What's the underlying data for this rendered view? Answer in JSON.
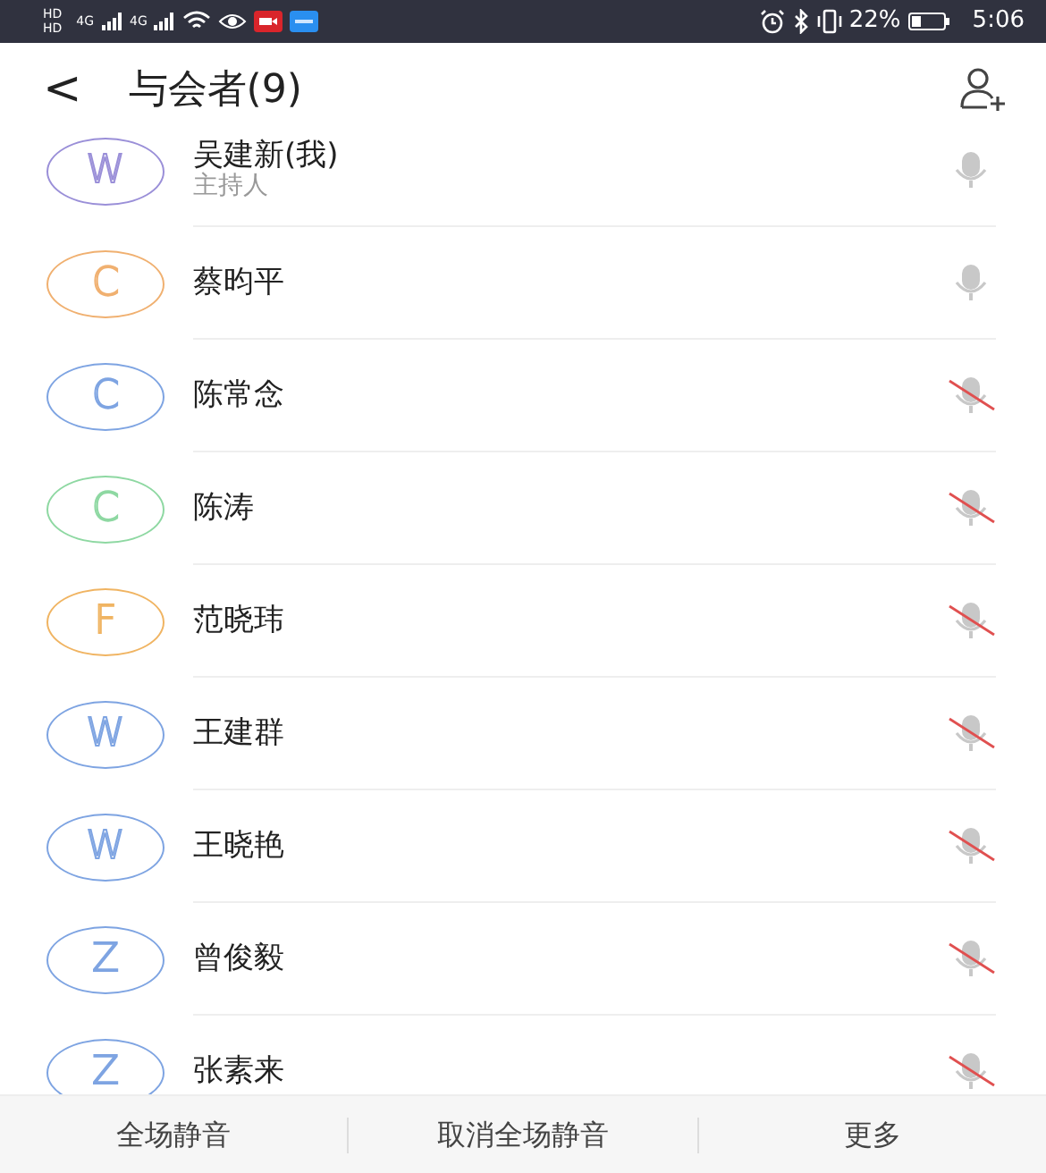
{
  "status_bar": {
    "hd_labels": [
      "HD",
      "HD"
    ],
    "network_labels": [
      "4G",
      "4G"
    ],
    "battery_percent": "22%",
    "time": "5:06"
  },
  "header": {
    "back": "<",
    "title": "与会者(9)"
  },
  "participants": [
    {
      "initial": "W",
      "color": "#9a8fd8",
      "name": "吴建新(我)",
      "role": "主持人",
      "muted": false
    },
    {
      "initial": "C",
      "color": "#f0b070",
      "name": "蔡昀平",
      "muted": false
    },
    {
      "initial": "C",
      "color": "#7ea4e2",
      "name": "陈常念",
      "muted": true
    },
    {
      "initial": "C",
      "color": "#8ed8a2",
      "name": "陈涛",
      "muted": true
    },
    {
      "initial": "F",
      "color": "#f0b462",
      "name": "范晓玮",
      "muted": true
    },
    {
      "initial": "W",
      "color": "#7ea4e2",
      "name": "王建群",
      "muted": true
    },
    {
      "initial": "W",
      "color": "#7ea4e2",
      "name": "王晓艳",
      "muted": true
    },
    {
      "initial": "Z",
      "color": "#7ea4e2",
      "name": "曾俊毅",
      "muted": true
    },
    {
      "initial": "Z",
      "color": "#7ea4e2",
      "name": "张素来",
      "muted": true
    }
  ],
  "bottom_actions": [
    "全场静音",
    "取消全场静音",
    "更多"
  ]
}
